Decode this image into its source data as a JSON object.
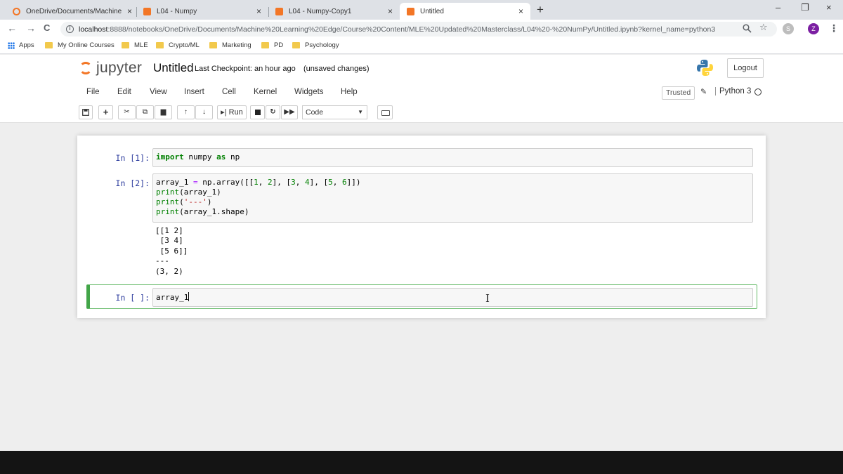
{
  "browser": {
    "tabs": [
      {
        "title": "OneDrive/Documents/Machine L",
        "close": "×"
      },
      {
        "title": "L04 - Numpy",
        "close": "×"
      },
      {
        "title": "L04 - Numpy-Copy1",
        "close": "×"
      },
      {
        "title": "Untitled",
        "close": "×"
      }
    ],
    "new_tab": "+",
    "window_controls": {
      "minimize": "–",
      "restore": "❐",
      "close": "×"
    },
    "nav": {
      "back": "←",
      "forward": "→",
      "reload": "C"
    },
    "url_host": "localhost",
    "url_rest": ":8888/notebooks/OneDrive/Documents/Machine%20Learning%20Edge/Course%20Content/MLE%20Updated%20Masterclass/L04%20-%20NumPy/Untitled.ipynb?kernel_name=python3",
    "omnibox_icons": {
      "zoom": "search-icon",
      "star": "star-icon"
    },
    "profile_initial": "Z",
    "menu_dots": "⋮",
    "bookmarks": [
      "Apps",
      "My Online Courses",
      "MLE",
      "Crypto/ML",
      "Marketing",
      "PD",
      "Psychology"
    ]
  },
  "jupyter": {
    "logo_text": "jupyter",
    "notebook_name": "Untitled",
    "checkpoint": "Last Checkpoint: an hour ago",
    "autosave_status": "(unsaved changes)",
    "logout_label": "Logout",
    "menu": [
      "File",
      "Edit",
      "View",
      "Insert",
      "Cell",
      "Kernel",
      "Widgets",
      "Help"
    ],
    "trusted_label": "Trusted",
    "kernel_name": "Python 3",
    "toolbar": {
      "run_label": "Run",
      "cell_type": "Code",
      "icons": [
        "save-icon",
        "plus-icon",
        "cut-icon",
        "copy-icon",
        "paste-icon",
        "arrow-up-icon",
        "arrow-down-icon",
        "run-icon",
        "stop-icon",
        "restart-icon",
        "fast-forward-icon",
        "keyboard-icon"
      ]
    },
    "cells": [
      {
        "prompt": "In [1]:",
        "source": [
          "import numpy as np"
        ],
        "output": []
      },
      {
        "prompt": "In [2]:",
        "source": [
          "array_1 = np.array([[1, 2], [3, 4], [5, 6]])",
          "print(array_1)",
          "print('---')",
          "print(array_1.shape)"
        ],
        "output": [
          "[[1 2]",
          " [3 4]",
          " [5 6]]",
          "---",
          "(3, 2)"
        ]
      },
      {
        "prompt": "In [ ]:",
        "source": [
          "array_1"
        ],
        "output": []
      }
    ]
  }
}
